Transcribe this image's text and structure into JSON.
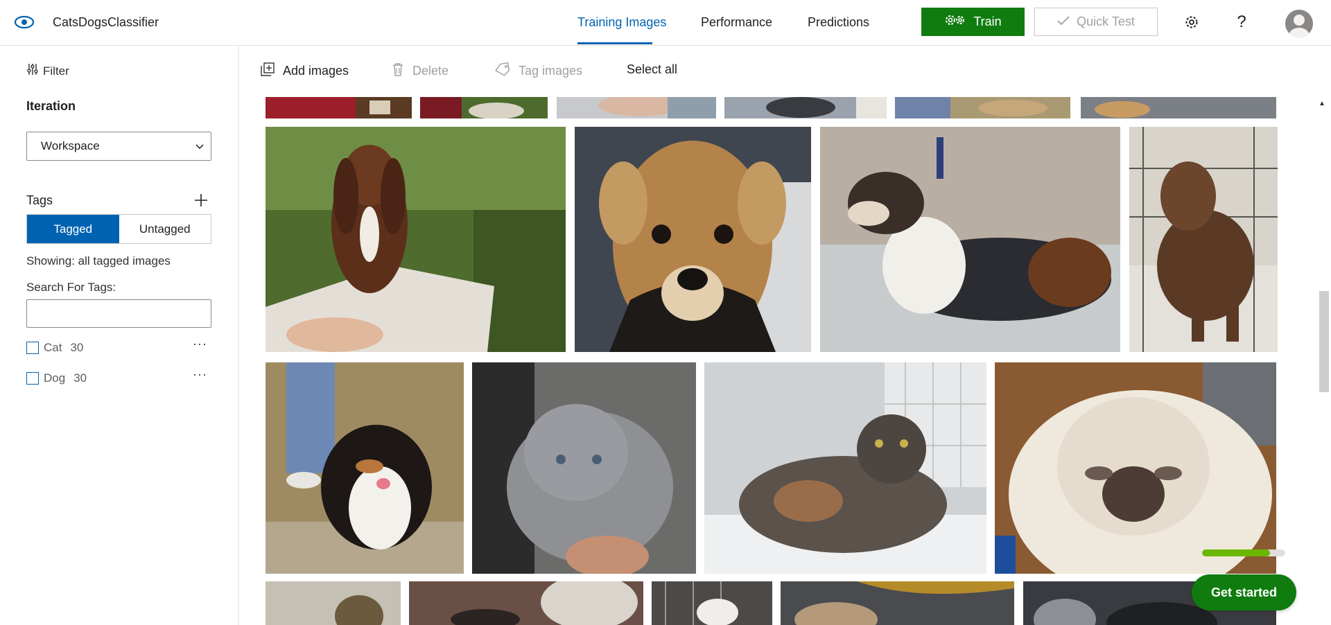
{
  "app": {
    "title": "CatsDogsClassifier"
  },
  "nav": {
    "tabs": [
      {
        "label": "Training Images",
        "active": true
      },
      {
        "label": "Performance",
        "active": false
      },
      {
        "label": "Predictions",
        "active": false
      }
    ]
  },
  "header": {
    "train_label": "Train",
    "quick_test_label": "Quick Test",
    "help_glyph": "?"
  },
  "sidebar": {
    "filter_label": "Filter",
    "iteration_label": "Iteration",
    "iteration_value": "Workspace",
    "tags_label": "Tags",
    "segment": {
      "tagged": "Tagged",
      "untagged": "Untagged",
      "selected": "Tagged"
    },
    "showing_text": "Showing: all tagged images",
    "search_label": "Search For Tags:",
    "search_value": "",
    "tags": [
      {
        "name": "Cat",
        "count": "30"
      },
      {
        "name": "Dog",
        "count": "30"
      }
    ],
    "more_glyph": "···"
  },
  "toolbar": {
    "add_images": "Add images",
    "delete": "Delete",
    "tag_images": "Tag images",
    "select_all": "Select all"
  },
  "images": {
    "row_partial": [
      "dog-partial-1",
      "dog-partial-2",
      "dog-partial-3",
      "dog-partial-4",
      "dog-partial-5",
      "dog-partial-6"
    ],
    "row1": [
      "basset-puppy",
      "tan-puppy",
      "tricolor-dog",
      "brown-dog"
    ],
    "row2": [
      "tricolor-small-dog",
      "gray-kitten",
      "tortoiseshell-cat",
      "siamese-cat"
    ],
    "row3": [
      "tabby-cat",
      "cat-with-person",
      "cat-in-cage",
      "cat-on-blanket",
      "gray-cat"
    ]
  },
  "progress": {
    "value": 0.82
  },
  "get_started_label": "Get started",
  "colors": {
    "accent": "#0063b1",
    "train_green": "#107c10",
    "progress_green": "#6bb700"
  }
}
